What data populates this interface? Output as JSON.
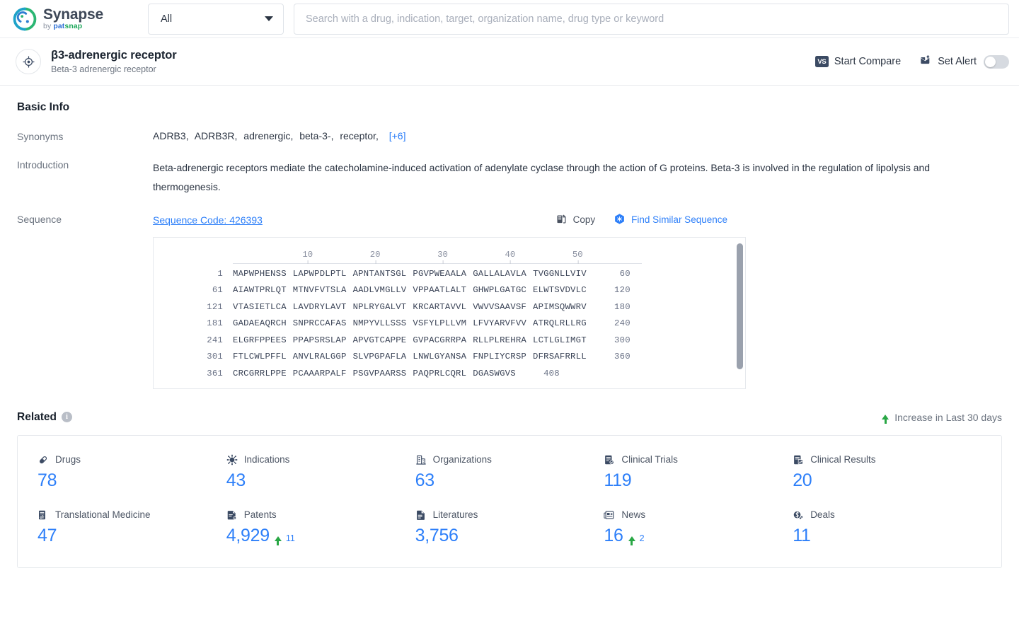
{
  "topbar": {
    "brand": {
      "name": "Synapse",
      "by": "by",
      "pat": "pat",
      "snap": "snap"
    },
    "scope": {
      "value": "All"
    },
    "search": {
      "placeholder": "Search with a drug, indication, target, organization name, drug type or keyword",
      "value": ""
    }
  },
  "entity": {
    "name": "β3-adrenergic receptor",
    "alias": "Beta-3 adrenergic receptor",
    "actions": {
      "compare_badge": "VS",
      "compare_label": "Start Compare",
      "alert_label": "Set Alert",
      "alert_on": false
    }
  },
  "basic_info": {
    "title": "Basic Info",
    "synonyms_label": "Synonyms",
    "synonyms": [
      "ADRB3",
      "ADRB3R",
      "adrenergic",
      "beta-3-",
      "receptor"
    ],
    "synonyms_more": "[+6]",
    "introduction_label": "Introduction",
    "introduction": "Beta-adrenergic receptors mediate the catecholamine-induced activation of adenylate cyclase through the action of G proteins. Beta-3 is involved in the regulation of lipolysis and thermogenesis.",
    "sequence_label": "Sequence",
    "sequence_code": "Sequence Code: 426393",
    "copy_label": "Copy",
    "find_similar_label": "Find Similar Sequence"
  },
  "sequence_viewer": {
    "ruler": [
      10,
      20,
      30,
      40,
      50
    ],
    "rows": [
      {
        "start": "1",
        "blocks": [
          "MAPWPHENSS",
          "LAPWPDLPTL",
          "APNTANTSGL",
          "PGVPWEAALA",
          "GALLALAVLA",
          "TVGGNLLVIV"
        ],
        "end": "60"
      },
      {
        "start": "61",
        "blocks": [
          "AIAWTPRLQT",
          "MTNVFVTSLA",
          "AADLVMGLLV",
          "VPPAATLALT",
          "GHWPLGATGC",
          "ELWTSVDVLC"
        ],
        "end": "120"
      },
      {
        "start": "121",
        "blocks": [
          "VTASIETLCA",
          "LAVDRYLAVT",
          "NPLRYGALVT",
          "KRCARTAVVL",
          "VWVVSAAVSF",
          "APIMSQWWRV"
        ],
        "end": "180"
      },
      {
        "start": "181",
        "blocks": [
          "GADAEAQRCH",
          "SNPRCCAFAS",
          "NMPYVLLSSS",
          "VSFYLPLLVM",
          "LFVYARVFVV",
          "ATRQLRLLRG"
        ],
        "end": "240"
      },
      {
        "start": "241",
        "blocks": [
          "ELGRFPPEES",
          "PPAPSRSLAP",
          "APVGTCAPPE",
          "GVPACGRRPA",
          "RLLPLREHRA",
          "LCTLGLIMGT"
        ],
        "end": "300"
      },
      {
        "start": "301",
        "blocks": [
          "FTLCWLPFFL",
          "ANVLRALGGP",
          "SLVPGPAFLA",
          "LNWLGYANSA",
          "FNPLIYCRSP",
          "DFRSAFRRLL"
        ],
        "end": "360"
      },
      {
        "start": "361",
        "blocks": [
          "CRCGRRLPPE",
          "PCAAARPALF",
          "PSGVPAARSS",
          "PAQPRLCQRL",
          "DGASWGVS"
        ],
        "end": "408"
      }
    ]
  },
  "related": {
    "title": "Related",
    "info_glyph": "i",
    "legend": "Increase in Last 30 days",
    "stats": [
      {
        "icon": "pill-icon",
        "label": "Drugs",
        "value": "78",
        "delta": null
      },
      {
        "icon": "virus-icon",
        "label": "Indications",
        "value": "43",
        "delta": null
      },
      {
        "icon": "building-icon",
        "label": "Organizations",
        "value": "63",
        "delta": null
      },
      {
        "icon": "clinical-trial-icon",
        "label": "Clinical Trials",
        "value": "119",
        "delta": null
      },
      {
        "icon": "clinical-result-icon",
        "label": "Clinical Results",
        "value": "20",
        "delta": null
      },
      {
        "icon": "translational-medicine-icon",
        "label": "Translational Medicine",
        "value": "47",
        "delta": null
      },
      {
        "icon": "patent-icon",
        "label": "Patents",
        "value": "4,929",
        "delta": "11"
      },
      {
        "icon": "literature-icon",
        "label": "Literatures",
        "value": "3,756",
        "delta": null
      },
      {
        "icon": "news-icon",
        "label": "News",
        "value": "16",
        "delta": "2"
      },
      {
        "icon": "deal-icon",
        "label": "Deals",
        "value": "11",
        "delta": null
      }
    ]
  },
  "colors": {
    "accent": "#2d7ff9",
    "increase": "#29a745",
    "muted": "#6b737f"
  }
}
